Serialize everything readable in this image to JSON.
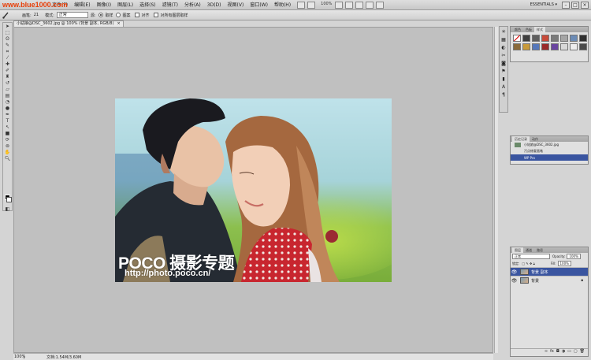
{
  "site_watermark": "www.blue1000.com",
  "menu": {
    "items": [
      "文件(F)",
      "编辑(E)",
      "图像(I)",
      "图层(L)",
      "选择(S)",
      "滤镜(T)",
      "分析(A)",
      "3D(D)",
      "视图(V)",
      "窗口(W)",
      "帮助(H)"
    ],
    "zoom": "100%",
    "workspace": "ESSENTIALS ▾",
    "win_min": "–",
    "win_max": "□",
    "win_close": "×"
  },
  "options": {
    "brush_label": "画笔:",
    "brush_size": "21",
    "mode_label": "模式:",
    "mode_value": "正常",
    "source_label": "源:",
    "option_sample": "取样",
    "option_pattern": "图案",
    "align_label": "对齐",
    "sample_all": "对所有图层取样"
  },
  "document": {
    "tab_title": "小姑娘@DSC_3602.jpg @ 100% (背景 副本, RGB/8)",
    "close": "×",
    "watermark_brand": "POCO 摄影专题",
    "watermark_url": "http://photo.poco.cn/"
  },
  "status": {
    "zoom": "100%",
    "doc_info": "文档:1.54M/3.60M"
  },
  "panels": {
    "styles_tabs": [
      "颜色",
      "色板",
      "样式"
    ],
    "history_tabs": [
      "历史记录",
      "动作"
    ],
    "history_items": [
      "小姑娘@DSC_3602.jpg",
      "污点修复画笔",
      "WP Pro"
    ],
    "layers_tabs": [
      "图层",
      "通道",
      "路径"
    ],
    "blend_mode": "正常",
    "opacity_label": "Opacity:",
    "opacity": "100%",
    "lock_label": "锁定:",
    "fill_label": "Fill:",
    "fill": "100%",
    "layers": [
      "背景 副本",
      "背景"
    ]
  }
}
